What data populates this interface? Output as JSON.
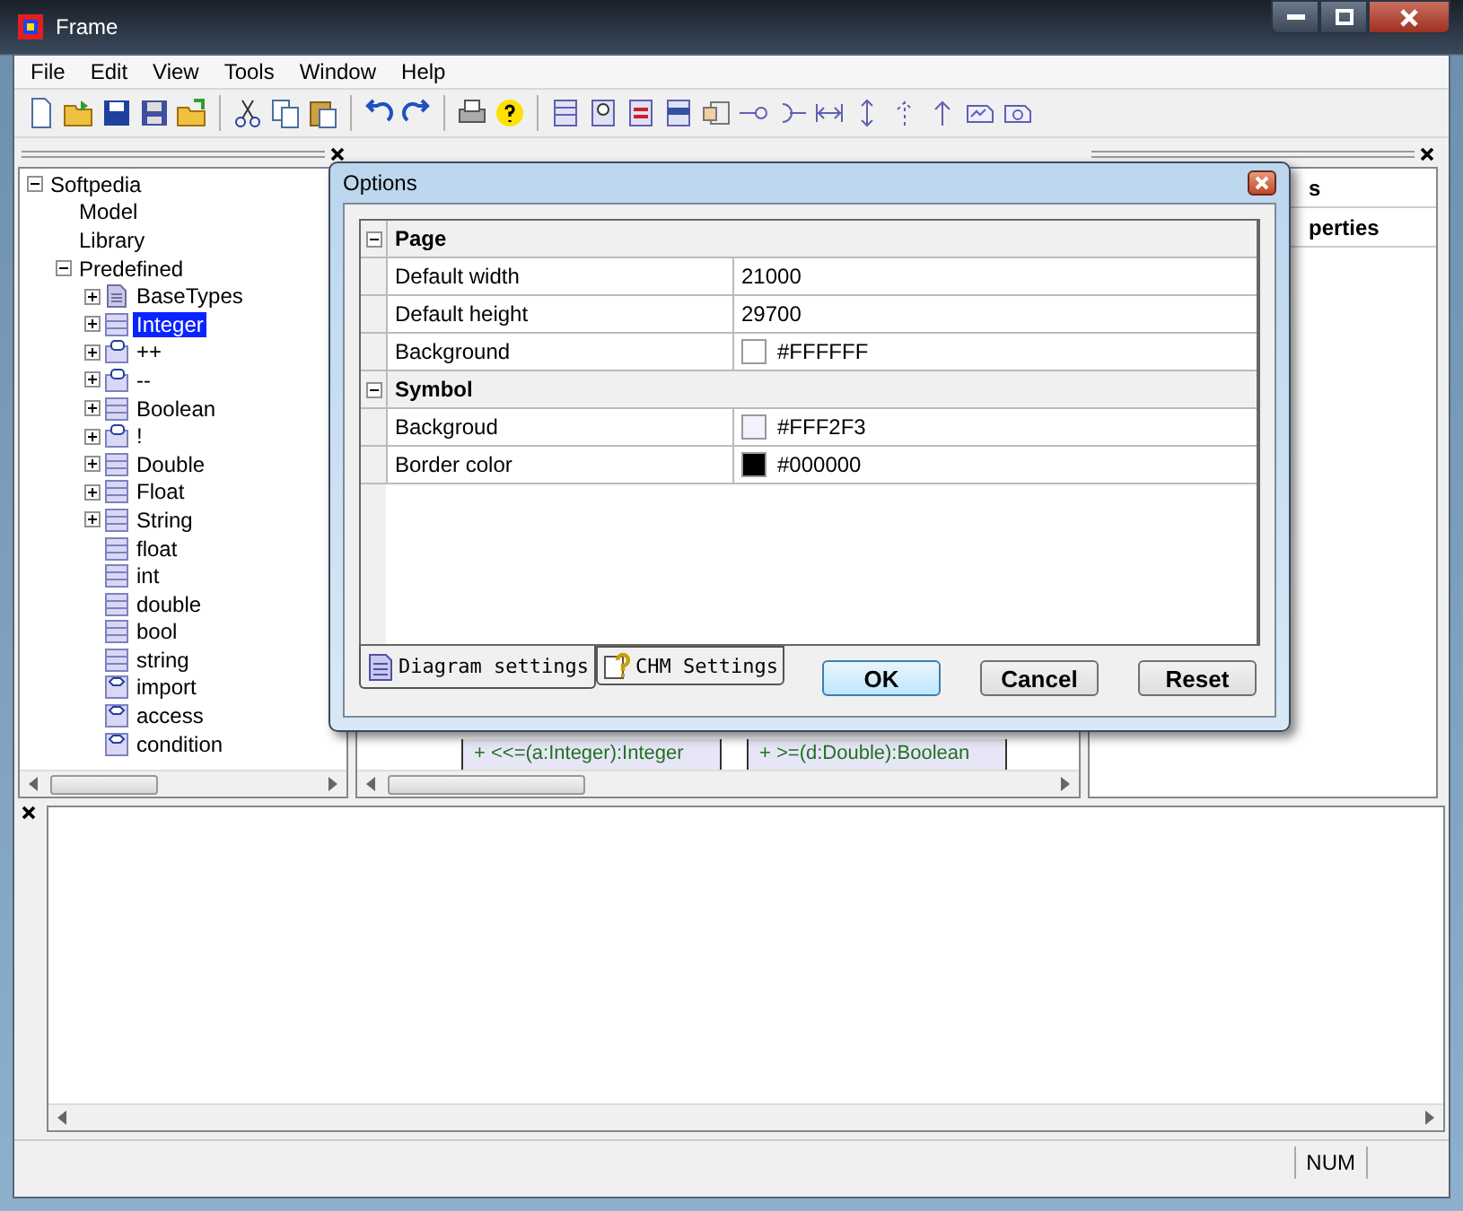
{
  "window": {
    "title": "Frame"
  },
  "menu": [
    "File",
    "Edit",
    "View",
    "Tools",
    "Window",
    "Help"
  ],
  "tree": [
    {
      "label": "Softpedia",
      "expanded": true,
      "selected": false,
      "children": [
        {
          "label": "Model",
          "selected": false
        },
        {
          "label": "Library",
          "selected": false
        },
        {
          "label": "Predefined",
          "expanded": true,
          "selected": false,
          "children": [
            {
              "label": "BaseTypes",
              "kind": "package",
              "expanded": false,
              "selected": false
            },
            {
              "label": "Integer",
              "kind": "class",
              "expanded": false,
              "selected": true
            },
            {
              "label": "++",
              "kind": "operator",
              "expanded": false,
              "selected": false
            },
            {
              "label": "--",
              "kind": "operator",
              "expanded": false,
              "selected": false
            },
            {
              "label": "Boolean",
              "kind": "class",
              "expanded": false,
              "selected": false
            },
            {
              "label": "!",
              "kind": "operator",
              "expanded": false,
              "selected": false
            },
            {
              "label": "Double",
              "kind": "class",
              "expanded": false,
              "selected": false
            },
            {
              "label": "Float",
              "kind": "class",
              "expanded": false,
              "selected": false
            },
            {
              "label": "String",
              "kind": "class",
              "expanded": false,
              "selected": false
            },
            {
              "label": "float",
              "kind": "class",
              "selected": false
            },
            {
              "label": "int",
              "kind": "class",
              "selected": false
            },
            {
              "label": "double",
              "kind": "class",
              "selected": false
            },
            {
              "label": "bool",
              "kind": "class",
              "selected": false
            },
            {
              "label": "string",
              "kind": "class",
              "selected": false
            },
            {
              "label": "import",
              "kind": "stereotype",
              "selected": false
            },
            {
              "label": "access",
              "kind": "stereotype",
              "selected": false
            },
            {
              "label": "condition",
              "kind": "stereotype",
              "selected": false
            }
          ]
        }
      ]
    }
  ],
  "diagram": {
    "members": [
      "+ <<=(a:Integer):Integer",
      "+ >=(d:Double):Boolean"
    ]
  },
  "properties_panel": {
    "rows": [
      "s",
      "perties"
    ]
  },
  "dialog": {
    "title": "Options",
    "groups": [
      {
        "name": "Page",
        "expanded": true,
        "rows": [
          {
            "name": "Default width",
            "value": "21000"
          },
          {
            "name": "Default height",
            "value": "29700"
          },
          {
            "name": "Background",
            "value": "#FFFFFF",
            "color": "#ffffff"
          }
        ]
      },
      {
        "name": "Symbol",
        "expanded": true,
        "rows": [
          {
            "name": "Backgroud",
            "value": "#FFF2F3",
            "color": "#f2f2ff"
          },
          {
            "name": "Border color",
            "value": "#000000",
            "color": "#000000"
          }
        ]
      }
    ],
    "tabs": [
      {
        "label": "Diagram settings",
        "kind": "document",
        "selected": true
      },
      {
        "label": "CHM Settings",
        "kind": "help",
        "selected": false
      }
    ],
    "buttons": [
      {
        "label": "OK",
        "default": true
      },
      {
        "label": "Cancel",
        "default": false
      },
      {
        "label": "Reset",
        "default": false
      }
    ]
  },
  "status_bar": {
    "indicator": "NUM"
  }
}
